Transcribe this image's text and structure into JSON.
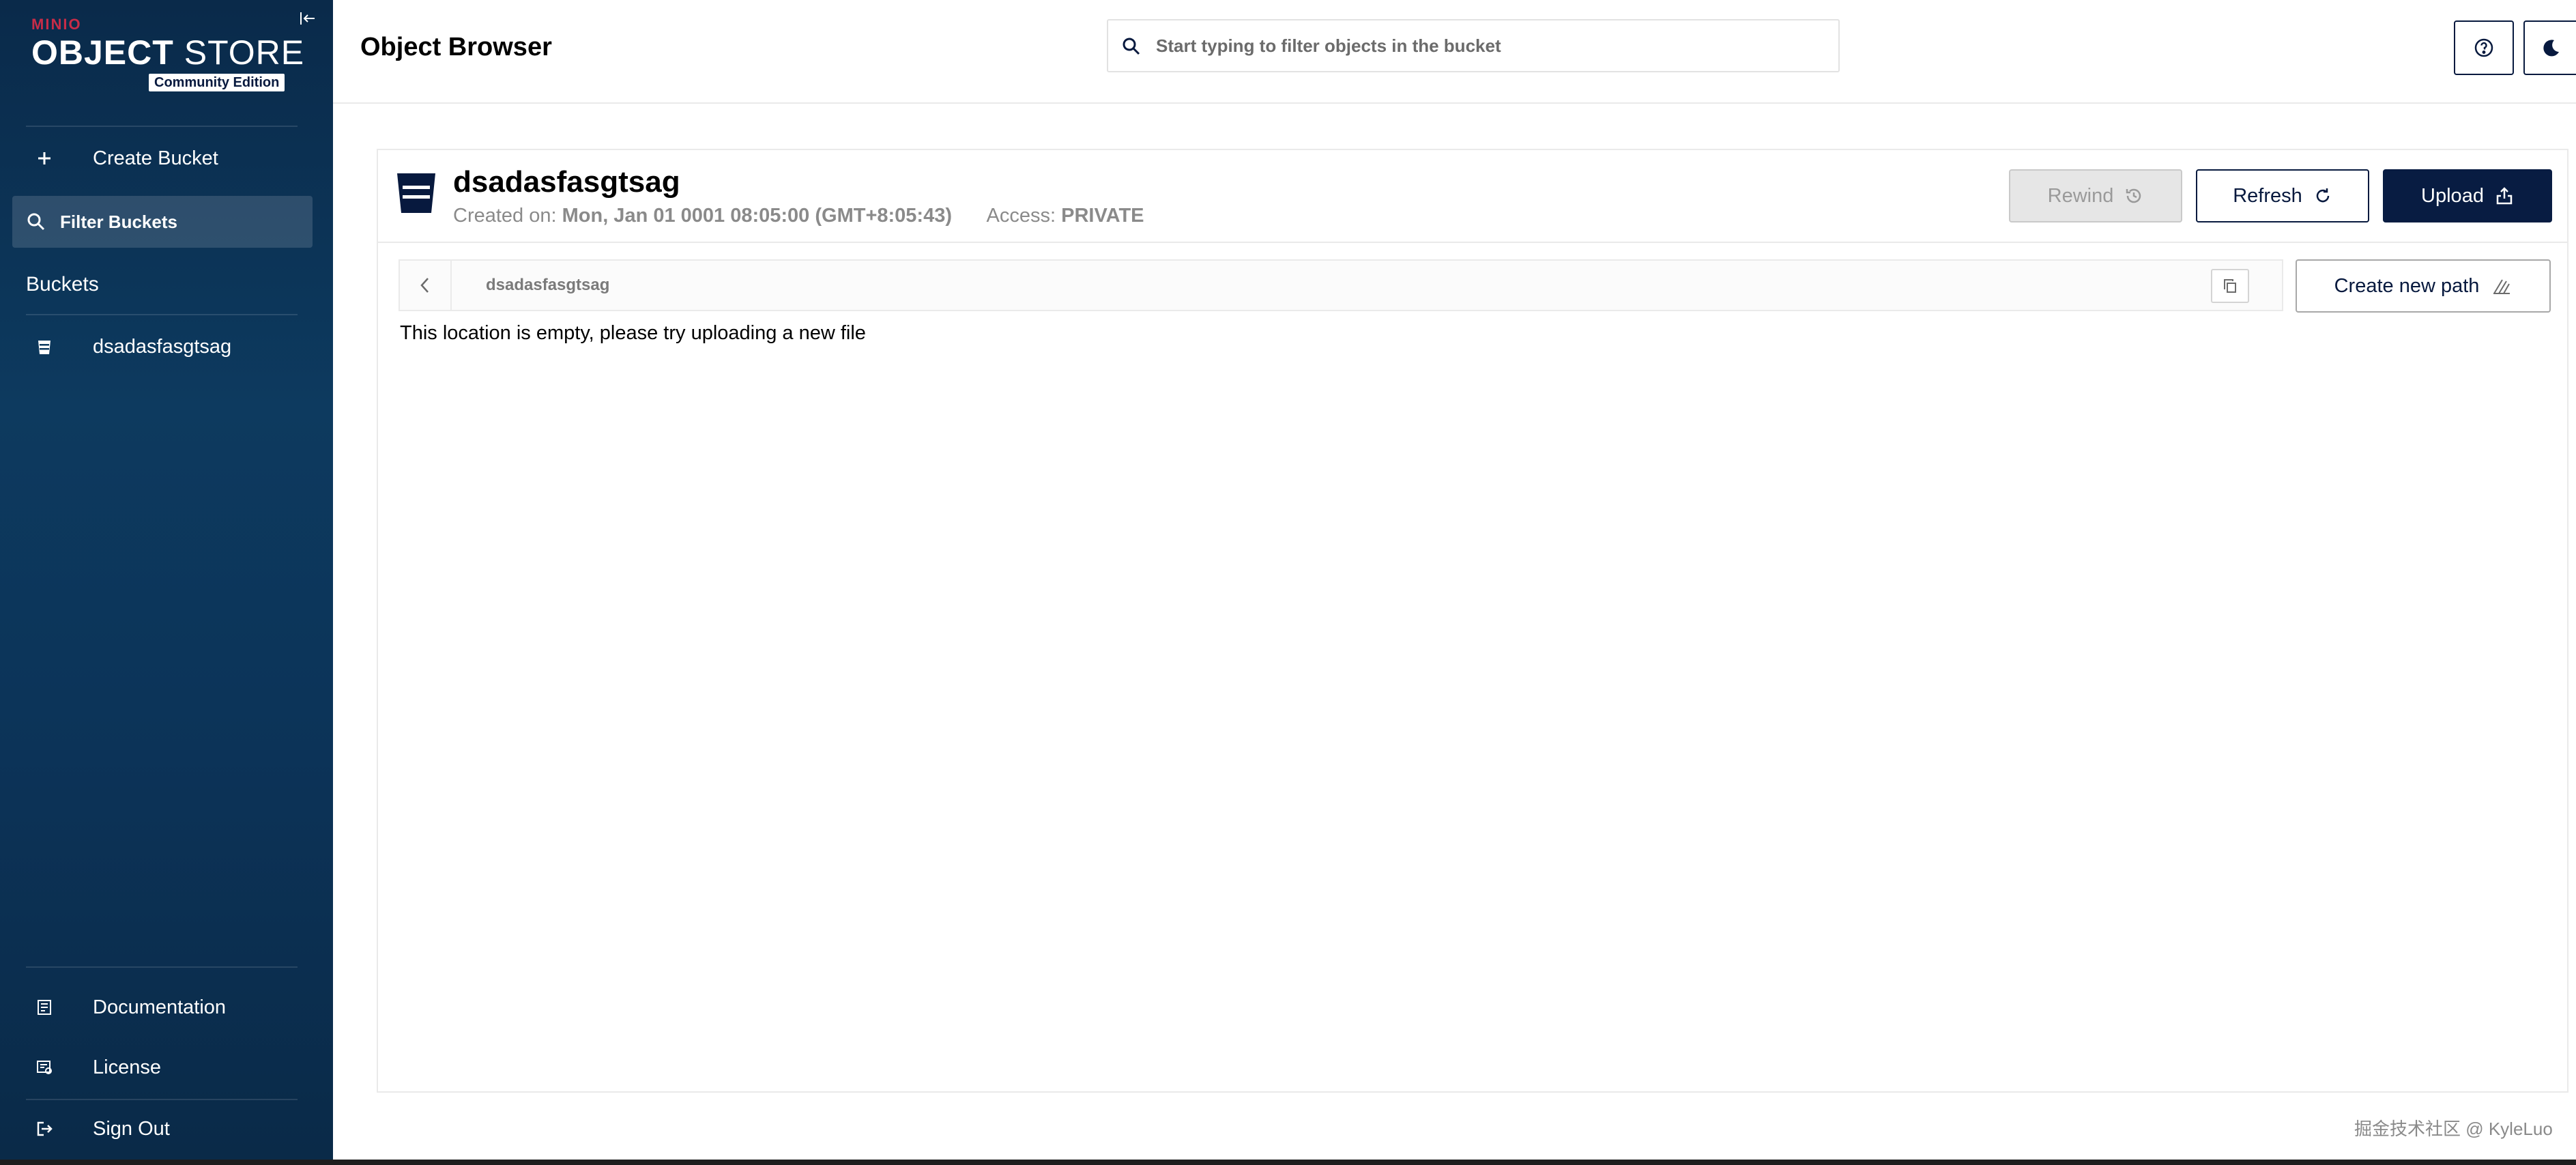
{
  "sidebar": {
    "logo": {
      "brand": "MINIO",
      "product_bold": "OBJECT",
      "product_thin": "STORE",
      "edition": "Community Edition"
    },
    "create_bucket_label": "Create Bucket",
    "filter_placeholder": "Filter Buckets",
    "buckets_title": "Buckets",
    "buckets": [
      {
        "name": "dsadasfasgtsag"
      }
    ],
    "footer": {
      "documentation": "Documentation",
      "license": "License",
      "sign_out": "Sign Out"
    }
  },
  "header": {
    "title": "Object Browser",
    "search_placeholder": "Start typing to filter objects in the bucket"
  },
  "bucket": {
    "name": "dsadasfasgtsag",
    "created_label": "Created on:",
    "created_value": "Mon, Jan 01 0001 08:05:00 (GMT+8:05:43)",
    "access_label": "Access:",
    "access_value": "PRIVATE"
  },
  "actions": {
    "rewind": "Rewind",
    "refresh": "Refresh",
    "upload": "Upload",
    "create_path": "Create new path"
  },
  "breadcrumb": {
    "path": "dsadasfasgtsag"
  },
  "empty_message": "This location is empty, please try uploading a new file",
  "watermark": "掘金技术社区 @ KyleLuo",
  "colors": {
    "sidebar_bg": "#0d3a5f",
    "primary": "#081c42",
    "brand_red": "#c72c48",
    "muted": "#8a8a8a"
  }
}
